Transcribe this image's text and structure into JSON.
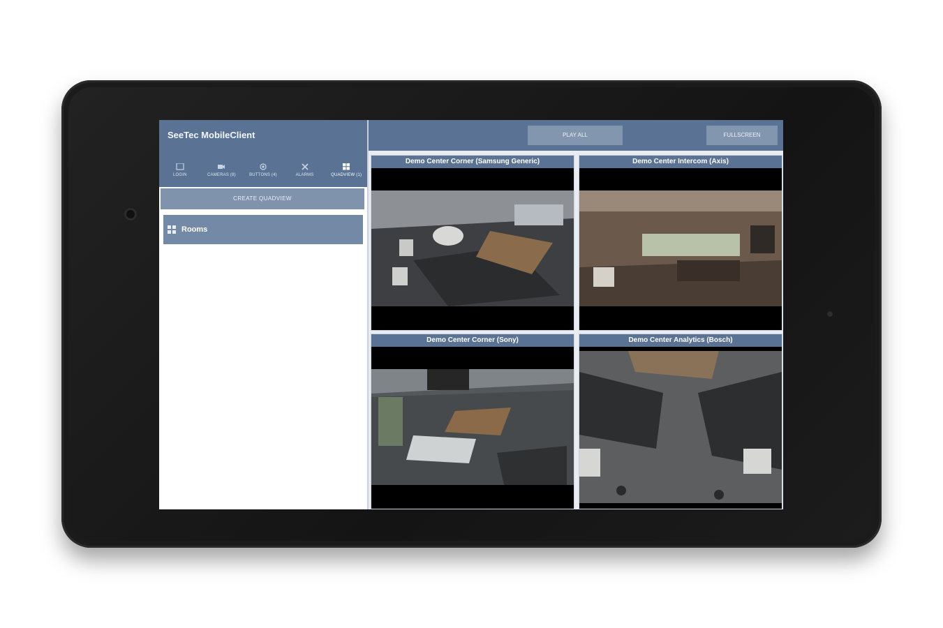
{
  "app": {
    "title": "SeeTec MobileClient"
  },
  "nav": [
    {
      "label": "LOGIN",
      "icon": "login-icon"
    },
    {
      "label": "CAMERAS (8)",
      "icon": "camera-icon"
    },
    {
      "label": "BUTTONS (4)",
      "icon": "button-icon"
    },
    {
      "label": "ALARMS",
      "icon": "alarm-icon"
    },
    {
      "label": "QUADVIEW (1)",
      "icon": "quadview-icon"
    }
  ],
  "sidebar": {
    "create_label": "CREATE QUADVIEW",
    "rooms_label": "Rooms"
  },
  "toolbar": {
    "play_all": "PLAY ALL",
    "fullscreen": "FULLSCREEN"
  },
  "cameras": [
    {
      "title": "Demo Center Corner (Samsung Generic)"
    },
    {
      "title": "Demo Center Intercom (Axis)"
    },
    {
      "title": "Demo Center Corner (Sony)"
    },
    {
      "title": "Demo Center Analytics (Bosch)"
    }
  ],
  "colors": {
    "header": "#5a7394",
    "button": "#8296b0",
    "list_item": "#7389a5"
  }
}
